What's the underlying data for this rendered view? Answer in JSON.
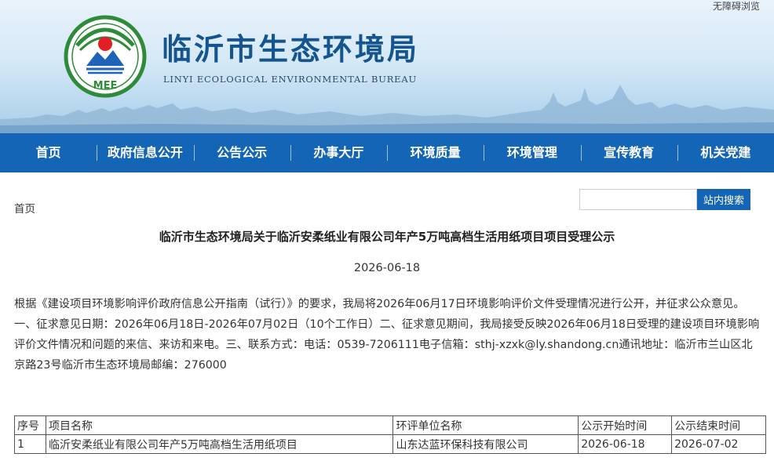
{
  "header": {
    "accessible_label": "无障碍浏览",
    "site_title": "临沂市生态环境局",
    "site_subtitle": "LINYI ECOLOGICAL ENVIRONMENTAL BUREAU",
    "logo_text": "MEE"
  },
  "nav": {
    "items": [
      {
        "label": "首页"
      },
      {
        "label": "政府信息公开"
      },
      {
        "label": "公告公示"
      },
      {
        "label": "办事大厅"
      },
      {
        "label": "环境质量"
      },
      {
        "label": "环境管理"
      },
      {
        "label": "宣传教育"
      },
      {
        "label": "机关党建"
      }
    ]
  },
  "search": {
    "placeholder": "",
    "button_label": "站内搜索"
  },
  "breadcrumb": "首页",
  "article": {
    "title": "临沂市生态环境局关于临沂安柔纸业有限公司年产5万吨高档生活用纸项目项目受理公示",
    "date": "2026-06-18",
    "body": "根据《建设项目环境影响评价政府信息公开指南（试行）》的要求，我局将2026年06月17日环境影响评价文件受理情况进行公开，并征求公众意见。一、征求意见日期：2026年06月18日-2026年07月02日（10个工作日）二、征求意见期间，我局接受反映2026年06月18日受理的建设项目环境影响评价文件情况和问题的来信、来访和来电。三、联系方式：电话：0539-7206111电子信箱：sthj-xzxk@ly.shandong.cn通讯地址：临沂市兰山区北京路23号临沂市生态环境局邮编：276000"
  },
  "table": {
    "headers": [
      "序号",
      "项目名称",
      "环评单位名称",
      "公示开始时间",
      "公示结束时间"
    ],
    "rows": [
      [
        "1",
        "临沂安柔纸业有限公司年产5万吨高档生活用纸项目",
        "山东达蓝环保科技有限公司",
        "2026-06-18",
        "2026-07-02"
      ]
    ]
  },
  "colors": {
    "brand_blue": "#1565b6",
    "title_blue": "#14548f",
    "logo_green": "#2e8b3a",
    "logo_red": "#e31e24"
  }
}
